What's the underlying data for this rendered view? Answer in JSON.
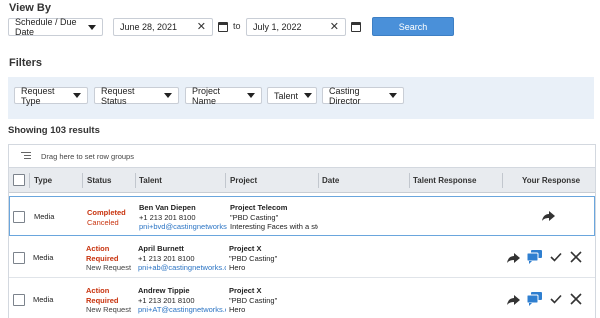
{
  "view_by": {
    "title": "View By",
    "mode": "Schedule / Due Date",
    "start_date": "June 28, 2021",
    "to_label": "to",
    "end_date": "July 1, 2022",
    "clear_glyph": "✕",
    "search_label": "Search"
  },
  "filters": {
    "title": "Filters",
    "chips": [
      "Request Type",
      "Request Status",
      "Project Name",
      "Talent",
      "Casting Director"
    ]
  },
  "results": {
    "summary": "Showing 103 results"
  },
  "grid": {
    "group_bar_text": "Drag here to set row groups",
    "columns": [
      "Type",
      "Status",
      "Talent",
      "Project",
      "Date",
      "Talent Response",
      "Your Response"
    ],
    "rows": [
      {
        "type": "Media",
        "status": "Completed",
        "status_sub": "Canceled",
        "talent_name": "Ben Van Diepen",
        "talent_phone": "+1 213 201 8100",
        "talent_email": "pni+bvd@castingnetworks.com",
        "project_name": "Project Telecom",
        "project_company": "\"PBD Casting\"",
        "project_desc": "Interesting Faces with a story",
        "date": "",
        "talent_response": ""
      },
      {
        "type": "Media",
        "status": "Action Required",
        "status_line1": "Action",
        "status_line2": "Required",
        "status_sub": "New Request",
        "talent_name": "April Burnett",
        "talent_phone": "+1 213 201 8100",
        "talent_email": "pni+ab@castingnetworks.com",
        "project_name": "Project X",
        "project_company": "\"PBD Casting\"",
        "project_desc": "Hero",
        "date": "",
        "talent_response": ""
      },
      {
        "type": "Media",
        "status": "Action Required",
        "status_line1": "Action",
        "status_line2": "Required",
        "status_sub": "New Request",
        "talent_name": "Andrew Tippie",
        "talent_phone": "+1 213 201 8100",
        "talent_email": "pni+AT@castingnetworks.com",
        "project_name": "Project X",
        "project_company": "\"PBD Casting\"",
        "project_desc": "Hero",
        "date": "",
        "talent_response": ""
      }
    ]
  },
  "colors": {
    "accent": "#4a90d9",
    "status_action": "#c8330e",
    "status_completed": "#c8330e",
    "link": "#2b74c4",
    "filter_band": "#e9f0f8",
    "icon_blue": "#2f7fd0"
  },
  "icons": [
    "chevron-down-icon",
    "clear-x-icon",
    "calendar-icon",
    "row-group-icon",
    "share-arrow-icon",
    "message-icon",
    "checkmark-icon",
    "decline-x-icon"
  ]
}
